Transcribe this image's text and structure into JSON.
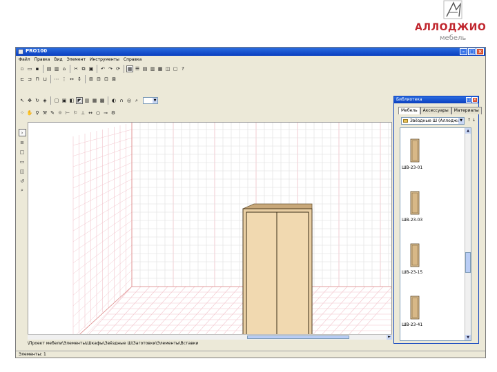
{
  "brand": {
    "name": "АЛЛОДЖИО",
    "subtitle": "мебель",
    "accent_color": "#c0262e"
  },
  "window": {
    "title": "PRO100",
    "controls": [
      "minimize",
      "maximize",
      "close"
    ]
  },
  "menu": {
    "items": [
      "Файл",
      "Правка",
      "Вид",
      "Элемент",
      "Инструменты",
      "Справка"
    ]
  },
  "library": {
    "title": "Библиотека",
    "tabs": [
      "Мебель",
      "Аксессуары",
      "Материалы"
    ],
    "active_tab": "Мебель",
    "folder": "Звёздные Ш (Аллоджио)",
    "nav": "↑ ↓",
    "items": [
      {
        "label": "ШВ-23-01"
      },
      {
        "label": "ШВ-23-03"
      },
      {
        "label": "ШВ-23-15"
      },
      {
        "label": "ШВ-23-41"
      }
    ]
  },
  "path_bar": {
    "text": "\\Проект мебели\\Элементы\\Шкафы\\Звёздные Ш\\Заготовки\\Элементы\\Вставки"
  },
  "status": {
    "text": "Элементы: 1"
  }
}
